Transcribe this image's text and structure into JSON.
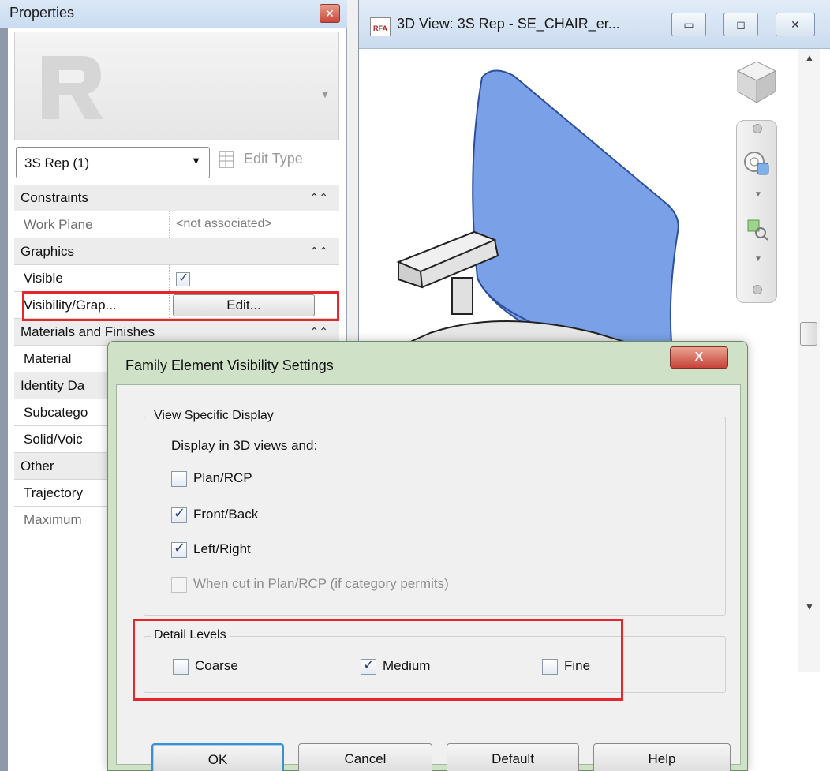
{
  "properties": {
    "title": "Properties",
    "close_glyph": "✕",
    "type_selector": "3S Rep (1)",
    "edit_type": "Edit Type",
    "groups": [
      {
        "label": "Constraints",
        "rows": [
          {
            "label": "Work Plane",
            "value": "<not associated>"
          }
        ]
      },
      {
        "label": "Graphics",
        "rows": [
          {
            "label": "Visible",
            "checked": true
          },
          {
            "label": "Visibility/Grap...",
            "button": "Edit..."
          }
        ]
      },
      {
        "label": "Materials and Finishes",
        "rows": [
          {
            "label": "Material"
          }
        ]
      },
      {
        "label": "Identity Da",
        "rows": [
          {
            "label": "Subcatego"
          },
          {
            "label": "Solid/Voic"
          }
        ]
      },
      {
        "label": "Other",
        "rows": [
          {
            "label": "Trajectory"
          },
          {
            "label": "Maximum"
          }
        ]
      }
    ]
  },
  "view": {
    "title": "3D View: 3S Rep - SE_CHAIR_er...",
    "rfa_badge": "RFA",
    "chair_color": "#7aa1e8"
  },
  "dialog": {
    "title": "Family Element Visibility Settings",
    "close_glyph": "X",
    "view_specific": {
      "legend": "View Specific Display",
      "intro": "Display in 3D views and:",
      "options": [
        {
          "label": "Plan/RCP",
          "checked": false,
          "enabled": true
        },
        {
          "label": "Front/Back",
          "checked": true,
          "enabled": true
        },
        {
          "label": "Left/Right",
          "checked": true,
          "enabled": true
        },
        {
          "label": "When cut in Plan/RCP (if category permits)",
          "checked": false,
          "enabled": false
        }
      ]
    },
    "detail_levels": {
      "legend": "Detail Levels",
      "options": [
        {
          "label": "Coarse",
          "checked": false
        },
        {
          "label": "Medium",
          "checked": true
        },
        {
          "label": "Fine",
          "checked": false
        }
      ]
    },
    "buttons": {
      "ok": "OK",
      "cancel": "Cancel",
      "default": "Default",
      "help": "Help"
    }
  },
  "highlight_color": "#e5262b"
}
